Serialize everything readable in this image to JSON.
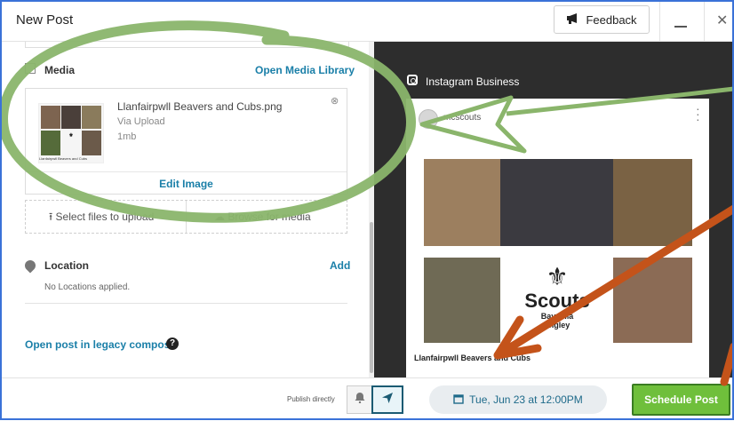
{
  "window": {
    "title": "New Post",
    "feedback_label": "Feedback"
  },
  "media": {
    "section_label": "Media",
    "open_library": "Open Media Library",
    "file_name": "Llanfairpwll Beavers and Cubs.png",
    "file_source": "Via Upload",
    "file_size": "1mb",
    "edit_image": "Edit Image",
    "select_files": "Select files to upload",
    "browse_media": "Browse for media",
    "thumb_caption": "Llanfairpwll Beavers and Cubs"
  },
  "location": {
    "label": "Location",
    "add": "Add",
    "empty": "No Locations applied."
  },
  "legacy": {
    "link": "Open post in legacy compose",
    "help": "?"
  },
  "preview": {
    "network": "Instagram Business",
    "account": "mcscouts",
    "caption": "Llanfairpwll Beavers and Cubs",
    "logo_text": "Scouts",
    "logo_sub": "Bays Mâ\nangley"
  },
  "footer": {
    "publish_directly": "Publish directly",
    "date": "Tue, Jun 23 at 12:00PM",
    "schedule": "Schedule Post"
  },
  "colors": {
    "link": "#1a7fa8",
    "schedule_bg": "#6fbf3b",
    "annotation_green": "#8ab56b",
    "annotation_orange": "#c4531a"
  }
}
